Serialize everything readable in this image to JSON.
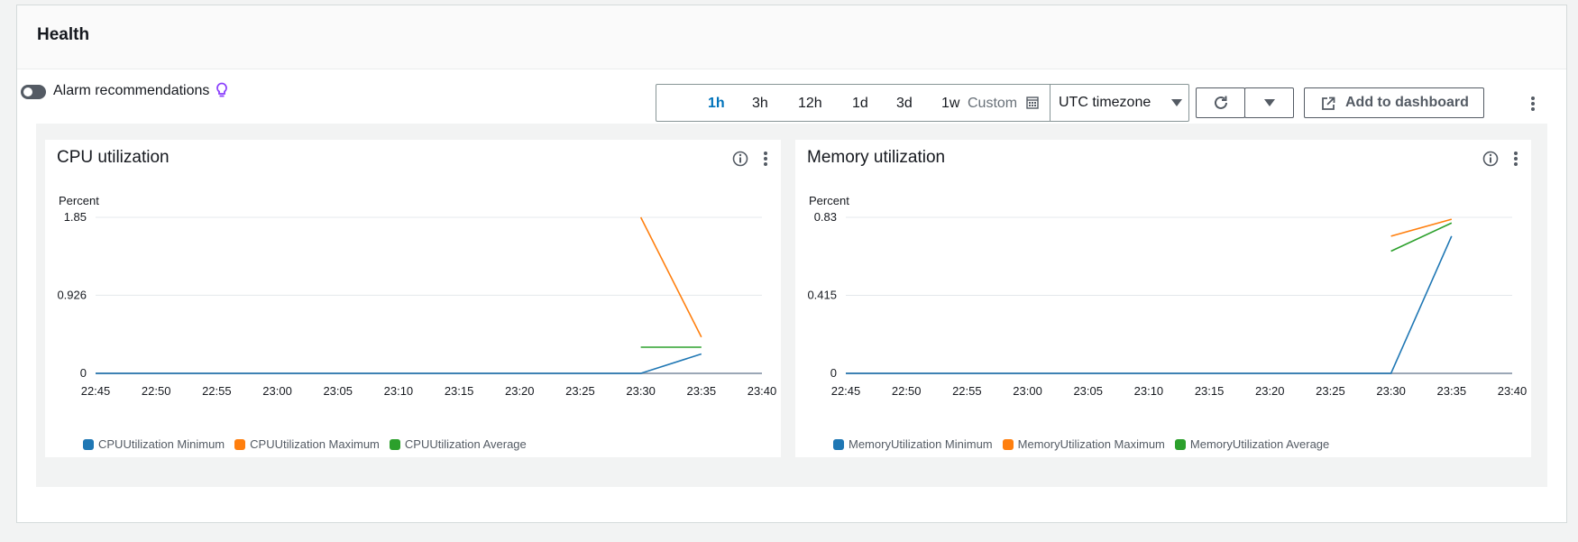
{
  "panel": {
    "title": "Health"
  },
  "alarm": {
    "label": "Alarm recommendations",
    "enabled": false
  },
  "time_range": {
    "options": [
      "1h",
      "3h",
      "12h",
      "1d",
      "3d",
      "1w"
    ],
    "active": "1h",
    "custom_label": "Custom",
    "timezone": "UTC timezone"
  },
  "toolbar": {
    "add_label": "Add to dashboard"
  },
  "colors": {
    "accent": "#0073bb",
    "min": "#1f77b4",
    "max": "#ff7f0e",
    "avg": "#2ca02c"
  },
  "widgets": {
    "cpu": {
      "title": "CPU utilization",
      "unit": "Percent"
    },
    "memory": {
      "title": "Memory utilization",
      "unit": "Percent"
    }
  },
  "chart_data": [
    {
      "type": "line",
      "title": "CPU utilization",
      "ylabel": "Percent",
      "ylim": [
        0,
        1.85
      ],
      "yticks": [
        "1.85",
        "0.926",
        "0"
      ],
      "x": [
        "22:45",
        "22:50",
        "22:55",
        "23:00",
        "23:05",
        "23:10",
        "23:15",
        "23:20",
        "23:25",
        "23:30",
        "23:35",
        "23:40"
      ],
      "series": [
        {
          "name": "CPUUtilization Minimum",
          "color": "#1f77b4",
          "points": [
            [
              "22:45",
              0
            ],
            [
              "23:30",
              0
            ],
            [
              "23:35",
              0.23
            ]
          ]
        },
        {
          "name": "CPUUtilization Maximum",
          "color": "#ff7f0e",
          "points": [
            [
              "23:30",
              1.85
            ],
            [
              "23:35",
              0.43
            ]
          ]
        },
        {
          "name": "CPUUtilization Average",
          "color": "#2ca02c",
          "points": [
            [
              "23:30",
              0.31
            ],
            [
              "23:35",
              0.31
            ]
          ]
        }
      ],
      "grid": true,
      "legend": "bottom"
    },
    {
      "type": "line",
      "title": "Memory utilization",
      "ylabel": "Percent",
      "ylim": [
        0,
        0.83
      ],
      "yticks": [
        "0.83",
        "0.415",
        "0"
      ],
      "x": [
        "22:45",
        "22:50",
        "22:55",
        "23:00",
        "23:05",
        "23:10",
        "23:15",
        "23:20",
        "23:25",
        "23:30",
        "23:35",
        "23:40"
      ],
      "series": [
        {
          "name": "MemoryUtilization Minimum",
          "color": "#1f77b4",
          "points": [
            [
              "22:45",
              0
            ],
            [
              "23:30",
              0
            ],
            [
              "23:35",
              0.73
            ]
          ]
        },
        {
          "name": "MemoryUtilization Maximum",
          "color": "#ff7f0e",
          "points": [
            [
              "23:30",
              0.73
            ],
            [
              "23:35",
              0.82
            ]
          ]
        },
        {
          "name": "MemoryUtilization Average",
          "color": "#2ca02c",
          "points": [
            [
              "23:30",
              0.65
            ],
            [
              "23:35",
              0.8
            ]
          ]
        }
      ],
      "grid": true,
      "legend": "bottom"
    }
  ]
}
